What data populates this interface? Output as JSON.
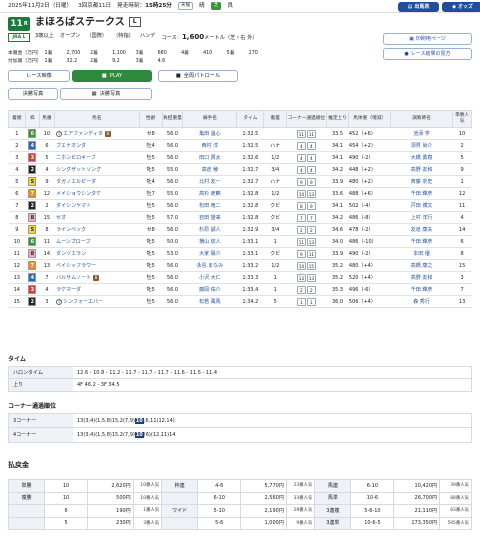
{
  "topbar": {
    "date": "2025年11月2日（日曜）",
    "meeting": "3回京都11日",
    "post_label": "発走時刻：",
    "post_time": "15時25分",
    "weather": "天候",
    "weather_val": "晴",
    "turf": "芝",
    "turf_val": "良",
    "btn_horses": "出馬表",
    "btn_odds": "オッズ"
  },
  "race": {
    "number": "11",
    "number_unit": "R",
    "grade_label": "JRA L",
    "name": "まほろばステークス",
    "listed": "L",
    "class": "3歳以上",
    "type": "オープン",
    "intl": "（国際）",
    "special": "（特指）",
    "handicap": "ハンデ",
    "course_label": "コース：",
    "distance": "1,600",
    "distance_unit": "メートル（芝・右 外）",
    "prize_label_1": "本賞金（万円）",
    "prize_label_2": "付加賞（万円）",
    "prize_1": [
      "1着",
      "2,700",
      "2着",
      "1,100",
      "3着",
      "680",
      "4着",
      "410",
      "5着",
      "270"
    ],
    "prize_2": [
      "1着",
      "32.2",
      "2着",
      "9.2",
      "3着",
      "4.6"
    ],
    "btn_print": "印刷用ページ",
    "btn_guide": "レース結果の見方"
  },
  "tabs": {
    "video": "レース映像",
    "play": "PLAY",
    "patrol": "全周パトロール",
    "photo_label": "決勝写真",
    "photo_btn": "決勝写真"
  },
  "table": {
    "headers": [
      "着順",
      "枠",
      "馬番",
      "馬名",
      "性齢",
      "負担重量",
      "騎手名",
      "タイム",
      "着差",
      "コーナー通過順位",
      "推定上り",
      "馬体重（増減）",
      "調教師名",
      "単勝人気"
    ],
    "rows": [
      {
        "pos": "1",
        "waku": "6",
        "num": "10",
        "name": "エアファンディタ",
        "mark": "マ",
        "blinker": true,
        "sex": "セ8",
        "wt": "56.0",
        "jockey": "亀田 温心",
        "time": "1:32.5",
        "margin": "",
        "c3": "11",
        "c4": "11",
        "last": "33.5",
        "bw": "452（+6）",
        "trainer": "池添 学",
        "pop": "10"
      },
      {
        "pos": "2",
        "waku": "4",
        "num": "6",
        "name": "ブエナオンダ",
        "mark": "",
        "blinker": false,
        "sex": "牡4",
        "wt": "56.0",
        "jockey": "西村 淳",
        "time": "1:32.5",
        "margin": "ハナ",
        "c3": "4",
        "c4": "4",
        "last": "34.1",
        "bw": "454（+2）",
        "trainer": "須貝 尚介",
        "pop": "2"
      },
      {
        "pos": "3",
        "waku": "3",
        "num": "5",
        "name": "ニホンピロキーフ",
        "mark": "",
        "blinker": false,
        "sex": "牡5",
        "wt": "56.0",
        "jockey": "田口 貫太",
        "time": "1:32.6",
        "margin": "1/2",
        "c3": "4",
        "c4": "4",
        "last": "34.1",
        "bw": "490（-2）",
        "trainer": "大橋 勇樹",
        "pop": "5"
      },
      {
        "pos": "4",
        "waku": "2",
        "num": "4",
        "name": "シングザットソング",
        "mark": "",
        "blinker": false,
        "sex": "牝5",
        "wt": "55.0",
        "jockey": "高倉 稜",
        "time": "1:32.7",
        "margin": "3/4",
        "c3": "4",
        "c4": "4",
        "last": "34.2",
        "bw": "448（+2）",
        "trainer": "高野 友和",
        "pop": "9"
      },
      {
        "pos": "5",
        "waku": "5",
        "num": "9",
        "name": "タガノエルピーダ",
        "mark": "",
        "blinker": false,
        "sex": "牝4",
        "wt": "56.0",
        "jockey": "北村 友一",
        "time": "1:32.7",
        "margin": "ハナ",
        "c3": "9",
        "c4": "9",
        "last": "33.9",
        "bw": "480（+2）",
        "trainer": "斉藤 崇史",
        "pop": "1"
      },
      {
        "pos": "6",
        "waku": "7",
        "num": "12",
        "name": "メイショウシンタケ",
        "mark": "",
        "blinker": false,
        "sex": "牡7",
        "wt": "55.0",
        "jockey": "高杉 吏麒",
        "time": "1:32.8",
        "margin": "1/2",
        "c3": "14",
        "c4": "13",
        "last": "33.6",
        "bw": "488（+6）",
        "trainer": "千田 輝彦",
        "pop": "12"
      },
      {
        "pos": "7",
        "waku": "2",
        "num": "2",
        "name": "ダイシンヤマト",
        "mark": "",
        "blinker": false,
        "sex": "牡5",
        "wt": "56.0",
        "jockey": "松田 竜二",
        "time": "1:32.8",
        "margin": "クビ",
        "c3": "8",
        "c4": "9",
        "last": "34.1",
        "bw": "502（-4）",
        "trainer": "戸田 博文",
        "pop": "11"
      },
      {
        "pos": "8",
        "waku": "8",
        "num": "15",
        "name": "セオ",
        "mark": "",
        "blinker": false,
        "sex": "牡5",
        "wt": "57.0",
        "jockey": "岩田 望来",
        "time": "1:32.8",
        "margin": "クビ",
        "c3": "7",
        "c4": "7",
        "last": "34.2",
        "bw": "486（-8）",
        "trainer": "上村 洋行",
        "pop": "4"
      },
      {
        "pos": "9",
        "waku": "5",
        "num": "8",
        "name": "ラインベック",
        "mark": "",
        "blinker": false,
        "sex": "セ8",
        "wt": "56.0",
        "jockey": "杉原 誠人",
        "time": "1:32.9",
        "margin": "3/4",
        "c3": "2",
        "c4": "2",
        "last": "34.6",
        "bw": "478（-2）",
        "trainer": "友道 康夫",
        "pop": "14"
      },
      {
        "pos": "10",
        "waku": "6",
        "num": "11",
        "name": "ムーンプローブ",
        "mark": "",
        "blinker": false,
        "sex": "牝5",
        "wt": "50.0",
        "jockey": "横山 琉人",
        "time": "1:33.1",
        "margin": "1",
        "c3": "11",
        "c4": "13",
        "last": "34.0",
        "bw": "486（-10）",
        "trainer": "千田 輝彦",
        "pop": "6"
      },
      {
        "pos": "11",
        "waku": "8",
        "num": "14",
        "name": "ダンツエラン",
        "mark": "",
        "blinker": false,
        "sex": "牝5",
        "wt": "53.0",
        "jockey": "大家 陽介",
        "time": "1:33.1",
        "margin": "クビ",
        "c3": "9",
        "c4": "11",
        "last": "33.9",
        "bw": "490（-2）",
        "trainer": "本田 優",
        "pop": "8"
      },
      {
        "pos": "12",
        "waku": "7",
        "num": "13",
        "name": "ベイシャフラワー",
        "mark": "",
        "blinker": false,
        "sex": "牝5",
        "wt": "56.0",
        "jockey": "永島 まなみ",
        "time": "1:33.2",
        "margin": "1/2",
        "c3": "14",
        "c4": "15",
        "last": "35.2",
        "bw": "480（+4）",
        "trainer": "高橋 康之",
        "pop": "15"
      },
      {
        "pos": "13",
        "waku": "4",
        "num": "7",
        "name": "バルサムノート",
        "mark": "",
        "blinker": true,
        "sex": "牡5",
        "wt": "56.0",
        "jockey": "小沢 大仁",
        "time": "1:33.3",
        "margin": "1",
        "c3": "13",
        "c4": "13",
        "last": "35.2",
        "bw": "520（+4）",
        "trainer": "高野 友和",
        "pop": "3"
      },
      {
        "pos": "14",
        "waku": "3",
        "num": "4",
        "name": "ラケマーダ",
        "mark": "",
        "blinker": false,
        "sex": "牝5",
        "wt": "56.0",
        "jockey": "藤岡 佑介",
        "time": "1:33.4",
        "margin": "1",
        "c3": "2",
        "c4": "2",
        "last": "35.3",
        "bw": "496（-6）",
        "trainer": "千田 輝彦",
        "pop": "7"
      },
      {
        "pos": "15",
        "waku": "2",
        "num": "3",
        "name": "シンフォーエバー",
        "mark": "マ",
        "blinker": false,
        "sex": "牡5",
        "wt": "56.0",
        "jockey": "松若 風馬",
        "time": "1:34.2",
        "margin": "5",
        "c3": "1",
        "c4": "1",
        "last": "36.0",
        "bw": "506（+4）",
        "trainer": "森 秀行",
        "pop": "13"
      }
    ]
  },
  "laps": {
    "title": "タイム",
    "halon_label": "ハロンタイム",
    "halon": "12.6 - 10.8 - 11.2 - 11.7 - 11.7 - 11.7 - 11.6 - 11.5 - 11.4",
    "agari_label": "上り",
    "agari": "4F 46.2 - 3F 34.5"
  },
  "corners": {
    "title": "コーナー通過順位",
    "c3_label": "3コーナー",
    "c3_pre": "13(3,4)(1,5,8)15,2(7,9)",
    "c3_hl": "10",
    "c3_post": ",6,11(12,14)",
    "c4_label": "4コーナー",
    "c4_pre": "13(3,4)(1,5,8)15,2(7,9)",
    "c4_hl": "10",
    "c4_post": "(6)(12,11)14"
  },
  "payout": {
    "title": "払戻金",
    "rows": [
      [
        "単勝",
        "10",
        "2,620円",
        "10番人気",
        "枠連",
        "4-6",
        "5,770円",
        "23番人気",
        "馬連",
        "6-10",
        "10,420円",
        "39番人気"
      ],
      [
        "複勝",
        "10",
        "500円",
        "10番人気",
        "",
        "6-10",
        "2,560円",
        "33番人気",
        "馬単",
        "10-6",
        "26,700円",
        "88番人気"
      ],
      [
        "",
        "6",
        "190円",
        "1番人気",
        "ワイド",
        "5-10",
        "2,190円",
        "28番人気",
        "3連複",
        "5-6-10",
        "21,110円",
        "83番人気"
      ],
      [
        "",
        "5",
        "230円",
        "3番人気",
        "",
        "5-6",
        "1,000円",
        "9番人気",
        "3連単",
        "10-6-5",
        "173,350円",
        "595番人気"
      ]
    ]
  },
  "colors": {
    "waku": {
      "1": [
        "#ffffff",
        "#222"
      ],
      "2": [
        "#222222",
        "#fff"
      ],
      "3": [
        "#e8352a",
        "#fff"
      ],
      "4": [
        "#2a64c8",
        "#fff"
      ],
      "5": [
        "#f3d82c",
        "#222"
      ],
      "6": [
        "#2d9a3c",
        "#fff"
      ],
      "7": [
        "#f28b1d",
        "#fff"
      ],
      "8": [
        "#f2a9c4",
        "#222"
      ]
    }
  }
}
